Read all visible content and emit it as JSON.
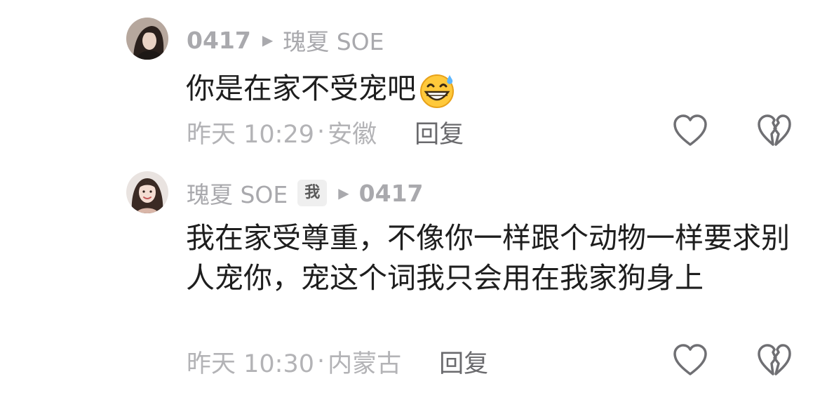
{
  "comments": [
    {
      "author_handle": "0417",
      "reply_to": "瑰夏 SOE",
      "body": "你是在家不受宠吧",
      "emoji": "grinning-sweat-emoji",
      "time": "昨天 10:29",
      "sep": "·",
      "location": "安徽",
      "reply_label": "回复"
    },
    {
      "author": "瑰夏 SOE",
      "me_badge": "我",
      "reply_to": "0417",
      "body": "我在家受尊重，不像你一样跟个动物一样要求别人宠你，宠这个词我只会用在我家狗身上",
      "time": "昨天 10:30",
      "sep": "·",
      "location": "内蒙古",
      "reply_label": "回复"
    }
  ],
  "icons": {
    "like": "heart-outline-icon",
    "dislike": "broken-heart-icon",
    "arrow": "play-triangle-icon"
  },
  "colors": {
    "meta": "#a9a9ad",
    "body": "#1e1e1e",
    "reply": "#6a6a6d"
  }
}
